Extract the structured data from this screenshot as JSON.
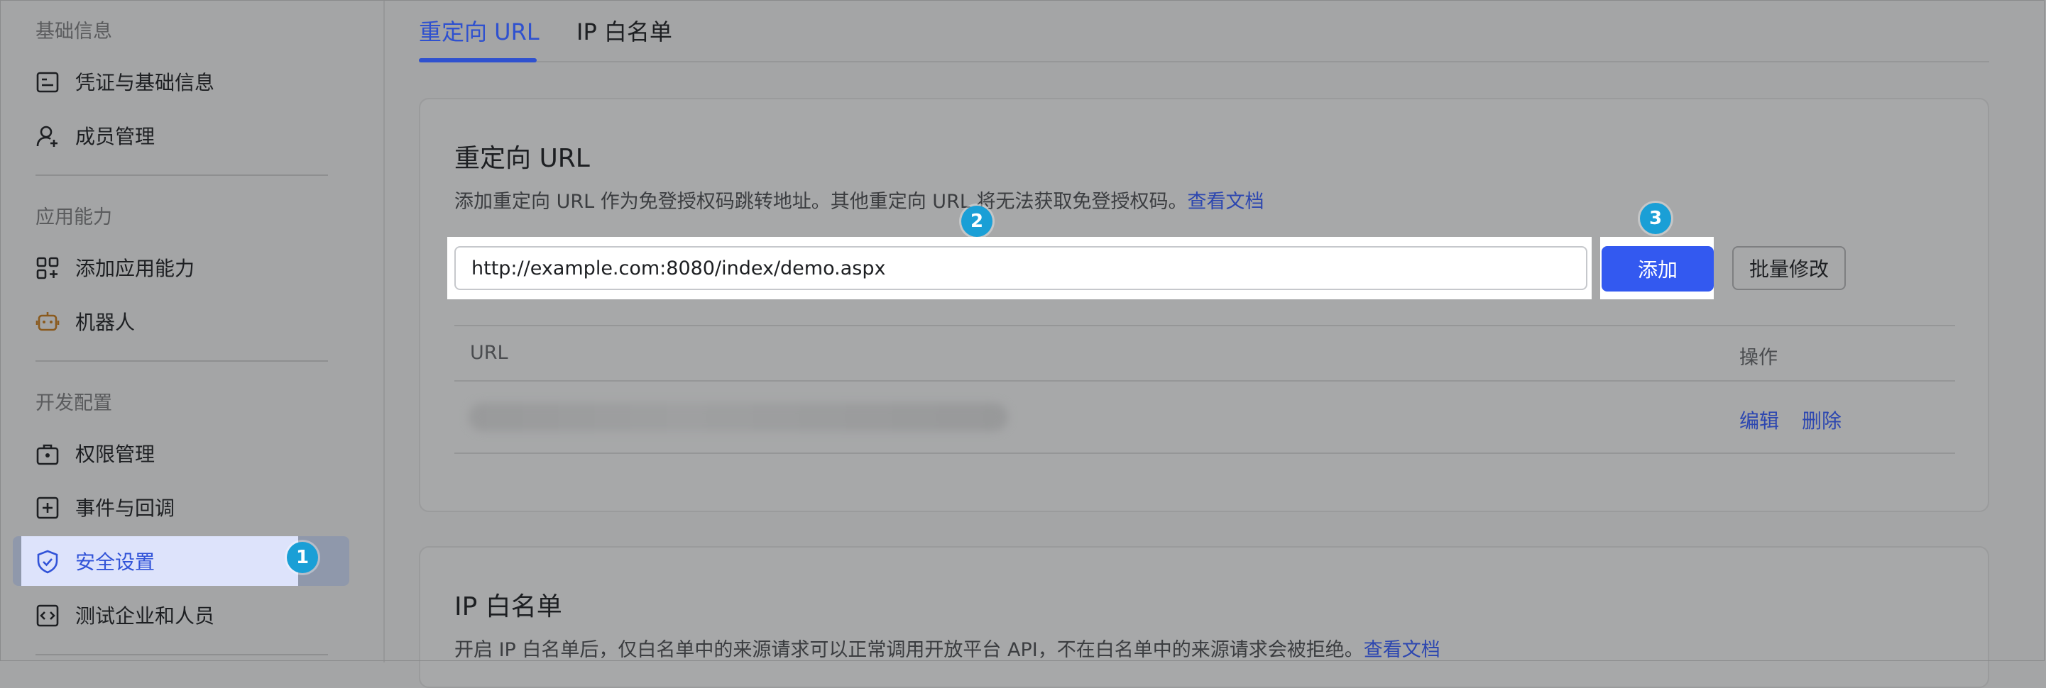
{
  "sidebar": {
    "sections": [
      {
        "title": "基础信息",
        "items": [
          {
            "label": "凭证与基础信息",
            "icon": "credential-card-icon"
          },
          {
            "label": "成员管理",
            "icon": "add-member-icon"
          }
        ]
      },
      {
        "title": "应用能力",
        "items": [
          {
            "label": "添加应用能力",
            "icon": "app-grid-add-icon"
          },
          {
            "label": "机器人",
            "icon": "robot-icon"
          }
        ]
      },
      {
        "title": "开发配置",
        "items": [
          {
            "label": "权限管理",
            "icon": "permission-icon"
          },
          {
            "label": "事件与回调",
            "icon": "event-callback-icon"
          },
          {
            "label": "安全设置",
            "icon": "shield-check-icon",
            "active": true
          },
          {
            "label": "测试企业和人员",
            "icon": "code-test-icon"
          }
        ]
      }
    ]
  },
  "tabs": [
    {
      "label": "重定向 URL",
      "active": true
    },
    {
      "label": "IP 白名单",
      "active": false
    }
  ],
  "redirect_card": {
    "title": "重定向 URL",
    "description": "添加重定向 URL 作为免登授权码跳转地址。其他重定向 URL 将无法获取免登授权码。",
    "doc_link": "查看文档",
    "input_value": "http://example.com:8080/index/demo.aspx",
    "add_button": "添加",
    "batch_button": "批量修改",
    "table": {
      "headers": [
        "URL",
        "操作"
      ],
      "rows": [
        {
          "actions": [
            "编辑",
            "删除"
          ]
        }
      ]
    }
  },
  "ip_card": {
    "title": "IP 白名单",
    "description": "开启 IP 白名单后，仅白名单中的来源请求可以正常调用开放平台 API，不在白名单中的来源请求会被拒绝。",
    "doc_link": "查看文档"
  },
  "step_badges": [
    "1",
    "2",
    "3"
  ],
  "colors": {
    "accent": "#3359f0",
    "link": "#2d47b0",
    "badge": "#1a9fd6"
  }
}
